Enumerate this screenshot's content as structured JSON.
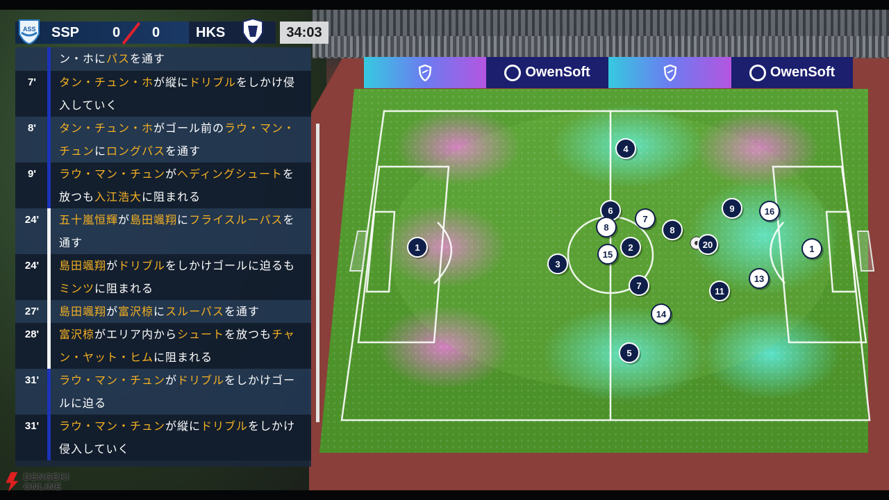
{
  "match": {
    "home_team": "SSP",
    "away_team": "HKS",
    "home_score": "0",
    "away_score": "0",
    "clock": "34:03",
    "home_crest_text": "ASS"
  },
  "ads": {
    "brand": "OwenSoft"
  },
  "colors": {
    "highlight": "#f4b022",
    "home_marker": "#0f1f4a",
    "away_marker": "#ffffff",
    "pitch": "#4f8f2a"
  },
  "commentary": [
    {
      "minute": "",
      "parts": [
        [
          "ン・ホに",
          0
        ],
        [
          "パス",
          1
        ],
        [
          "を通す",
          0
        ]
      ]
    },
    {
      "minute": "7'",
      "parts": [
        [
          "タン・チュン・ホ",
          1
        ],
        [
          "が縦に",
          0
        ],
        [
          "ドリブル",
          1
        ],
        [
          "をしかけ侵入していく",
          0
        ]
      ]
    },
    {
      "minute": "8'",
      "parts": [
        [
          "タン・チュン・ホ",
          1
        ],
        [
          "がゴール前の",
          0
        ],
        [
          "ラウ・マン・チュン",
          1
        ],
        [
          "に",
          0
        ],
        [
          "ロングパス",
          1
        ],
        [
          "を通す",
          0
        ]
      ]
    },
    {
      "minute": "9'",
      "parts": [
        [
          "ラウ・マン・チュン",
          1
        ],
        [
          "が",
          0
        ],
        [
          "ヘディングシュート",
          1
        ],
        [
          "を放つも",
          0
        ],
        [
          "入江浩大",
          1
        ],
        [
          "に阻まれる",
          0
        ]
      ]
    },
    {
      "minute": "24'",
      "parts": [
        [
          "五十嵐恒輝",
          1
        ],
        [
          "が",
          0
        ],
        [
          "島田颯翔",
          1
        ],
        [
          "に",
          0
        ],
        [
          "フライスルーパス",
          1
        ],
        [
          "を通す",
          0
        ]
      ]
    },
    {
      "minute": "24'",
      "parts": [
        [
          "島田颯翔",
          1
        ],
        [
          "が",
          0
        ],
        [
          "ドリブル",
          1
        ],
        [
          "をしかけゴールに迫るも",
          0
        ],
        [
          "ミンツ",
          1
        ],
        [
          "に阻まれる",
          0
        ]
      ]
    },
    {
      "minute": "27'",
      "parts": [
        [
          "島田颯翔",
          1
        ],
        [
          "が",
          0
        ],
        [
          "富沢椋",
          1
        ],
        [
          "に",
          0
        ],
        [
          "スルーパス",
          1
        ],
        [
          "を通す",
          0
        ]
      ]
    },
    {
      "minute": "28'",
      "parts": [
        [
          "富沢椋",
          1
        ],
        [
          "がエリア内から",
          0
        ],
        [
          "シュート",
          1
        ],
        [
          "を放つも",
          0
        ],
        [
          "チャン・ヤット・ヒム",
          1
        ],
        [
          "に阻まれる",
          0
        ]
      ]
    },
    {
      "minute": "31'",
      "parts": [
        [
          "ラウ・マン・チュン",
          1
        ],
        [
          "が",
          0
        ],
        [
          "ドリブル",
          1
        ],
        [
          "をしかけゴールに迫る",
          0
        ]
      ]
    },
    {
      "minute": "31'",
      "parts": [
        [
          "ラウ・マン・チュン",
          1
        ],
        [
          "が縦に",
          0
        ],
        [
          "ドリブル",
          1
        ],
        [
          "をしかけ侵入していく",
          0
        ]
      ]
    }
  ],
  "players": [
    {
      "num": "1",
      "team": "home"
    },
    {
      "num": "3",
      "team": "home"
    },
    {
      "num": "4",
      "team": "home"
    },
    {
      "num": "5",
      "team": "home"
    },
    {
      "num": "6",
      "team": "home"
    },
    {
      "num": "7",
      "team": "home"
    },
    {
      "num": "2",
      "team": "home"
    },
    {
      "num": "8",
      "team": "home"
    },
    {
      "num": "20",
      "team": "home"
    },
    {
      "num": "9",
      "team": "home"
    },
    {
      "num": "11",
      "team": "home"
    },
    {
      "num": "8",
      "team": "away"
    },
    {
      "num": "7",
      "team": "away"
    },
    {
      "num": "15",
      "team": "away"
    },
    {
      "num": "14",
      "team": "away"
    },
    {
      "num": "13",
      "team": "away"
    },
    {
      "num": "16",
      "team": "away"
    },
    {
      "num": "1",
      "team": "away"
    }
  ],
  "watermark": "DENGEKI ONLINE"
}
